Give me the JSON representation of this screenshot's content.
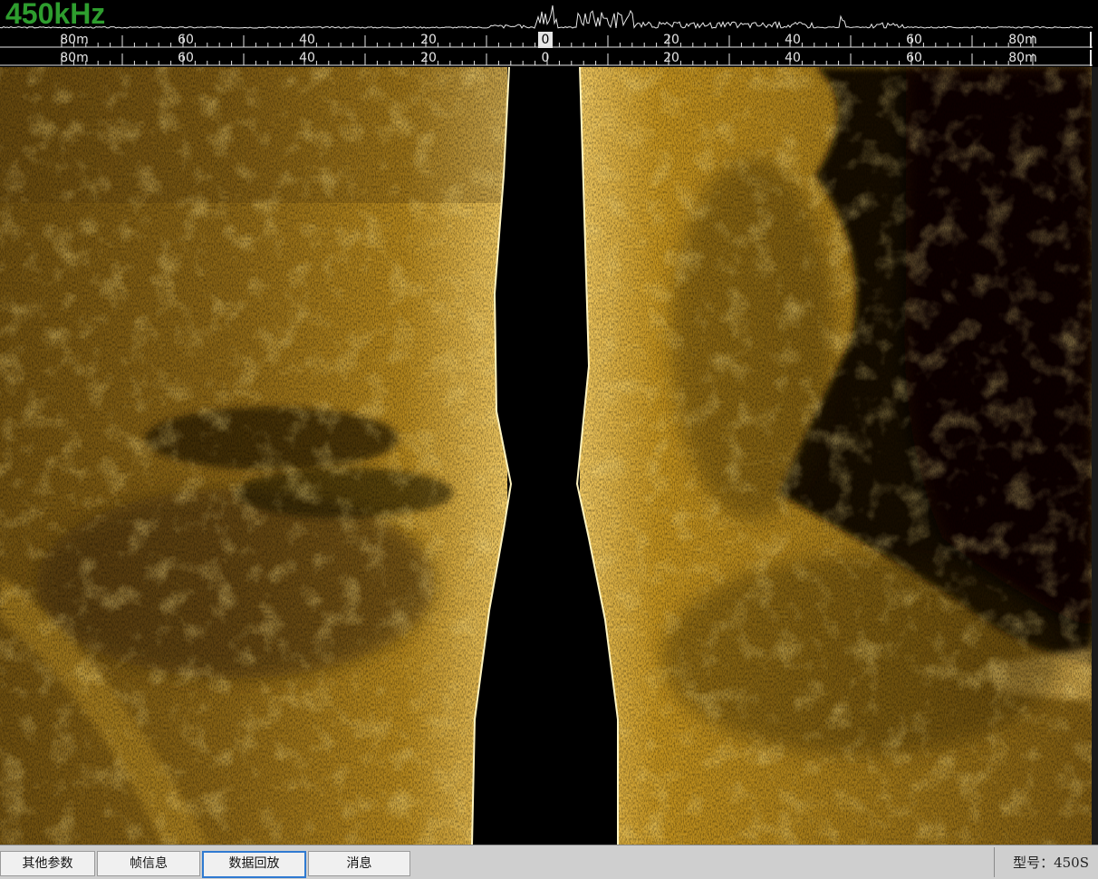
{
  "header": {
    "frequency_label": "450kHz",
    "frequency_color": "#2e9d2e"
  },
  "range_scale": {
    "ruler_top": {
      "left_labels": [
        "80m",
        "60",
        "40",
        "20"
      ],
      "center_label": "0",
      "right_labels": [
        "20",
        "40",
        "60",
        "80m"
      ]
    },
    "ruler_bottom": {
      "left_labels": [
        "80m",
        "60",
        "40",
        "20"
      ],
      "center_label": "0",
      "right_labels": [
        "20",
        "40",
        "60",
        "80m"
      ]
    }
  },
  "sonar_view": {
    "palette": "amber",
    "colors": {
      "bright": "#f0c860",
      "mid": "#b08020",
      "dark": "#3a2808",
      "water_column": "#000000"
    }
  },
  "bottom_bar": {
    "tabs": [
      {
        "label": "其他参数",
        "active": false
      },
      {
        "label": "帧信息",
        "active": false
      },
      {
        "label": "数据回放",
        "active": true
      },
      {
        "label": "消息",
        "active": false
      }
    ],
    "model_label": "型号：450S"
  }
}
